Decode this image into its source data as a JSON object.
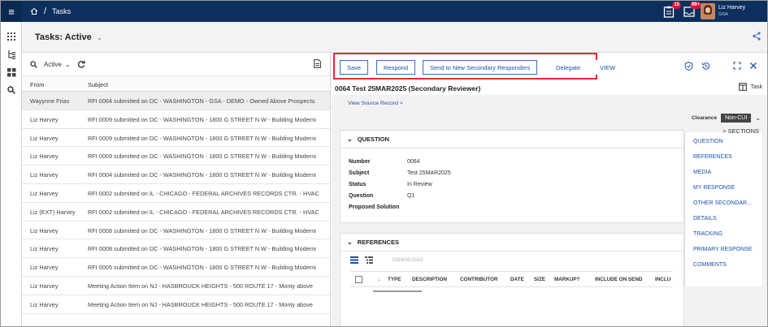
{
  "topbar": {
    "breadcrumb_page": "Tasks",
    "separator": "/",
    "notifications_badge": "15",
    "messages_badge": "99+",
    "user_name": "Liz Harvey",
    "user_org": "GSA",
    "colors": {
      "bar": "#0d2f5e",
      "badge": "#e0123c"
    }
  },
  "page": {
    "title": "Tasks: Active"
  },
  "list": {
    "filter_label": "Active",
    "columns": {
      "from": "From",
      "subject": "Subject"
    },
    "rows": [
      {
        "from": "Wayynne Frias",
        "subject": "RFI 0064 submitted on DC - WASHINGTON - GSA - DEMO - Owned Above Prospectu"
      },
      {
        "from": "Liz Harvey",
        "subject": "RFI 0009 submitted on DC - WASHINGTON - 1800 G STREET N W - Building Moderni"
      },
      {
        "from": "Liz Harvey",
        "subject": "RFI 0009 submitted on DC - WASHINGTON - 1800 G STREET N W - Building Moderni"
      },
      {
        "from": "Liz Harvey",
        "subject": "RFI 0009 submitted on DC - WASHINGTON - 1800 G STREET N W - Building Moderni"
      },
      {
        "from": "Liz Harvey",
        "subject": "RFI 0004 submitted on DC - WASHINGTON - 1800 G STREET N W - Building Moderni"
      },
      {
        "from": "Liz Harvey",
        "subject": "RFI 0002 submitted on IL - CHICAGO - FEDERAL ARCHIVES RECORDS CTR. - HVAC"
      },
      {
        "from": "Liz (EXT) Harvey",
        "subject": "RFI 0002 submitted on IL - CHICAGO - FEDERAL ARCHIVES RECORDS CTR. - HVAC"
      },
      {
        "from": "Liz Harvey",
        "subject": "RFI 0008 submitted on DC - WASHINGTON - 1800 G STREET N W - Building Moderni"
      },
      {
        "from": "Liz Harvey",
        "subject": "RFI 0008 submitted on DC - WASHINGTON - 1800 G STREET N W - Building Moderni"
      },
      {
        "from": "Liz Harvey",
        "subject": "RFI 0005 submitted on DC - WASHINGTON - 1800 G STREET N W - Building Moderni"
      },
      {
        "from": "Liz Harvey",
        "subject": "Meeting Action Item on NJ - HASBROUCK HEIGHTS - 500 ROUTE 17 - Monty above"
      },
      {
        "from": "Liz Harvey",
        "subject": "Meeting Action Item on NJ - HASBROUCK HEIGHTS - 500 ROUTE 17 - Monty above"
      }
    ]
  },
  "toolbar": {
    "save": "Save",
    "respond": "Respond",
    "send_secondary": "Send to New Secondary Responders",
    "delegate": "Delegate",
    "view": "VIEW",
    "highlight_color": "#e0293a"
  },
  "detail": {
    "title": "0064 Test 25MAR2025 (Secondary Reviewer)",
    "task_label": "Task",
    "view_source": "View Source Record >",
    "clearance_label": "Clearance",
    "clearance_value": "Non-CUI"
  },
  "question": {
    "header": "QUESTION",
    "fields": {
      "number_label": "Number",
      "number_value": "0064",
      "subject_label": "Subject",
      "subject_value": "Test 25MAR2025",
      "status_label": "Status",
      "status_value": "In Review",
      "question_label": "Question",
      "question_value": "Q1",
      "solution_label": "Proposed Solution"
    }
  },
  "references": {
    "header": "REFERENCES",
    "download": "DOWNLOAD",
    "columns": {
      "type": "TYPE",
      "description": "DESCRIPTION",
      "contributor": "CONTRIBUTOR",
      "date": "DATE",
      "size": "SIZE",
      "markup": "MARKUP?",
      "include": "INCLUDE ON SEND",
      "incl": "INCLU"
    }
  },
  "sections": {
    "header": "> SECTIONS",
    "items": [
      "QUESTION",
      "REFERENCES",
      "MEDIA",
      "MY RESPONSE",
      "OTHER SECONDAR...",
      "DETAILS",
      "TRACKING",
      "PRIMARY RESPONSE",
      "COMMENTS"
    ]
  }
}
